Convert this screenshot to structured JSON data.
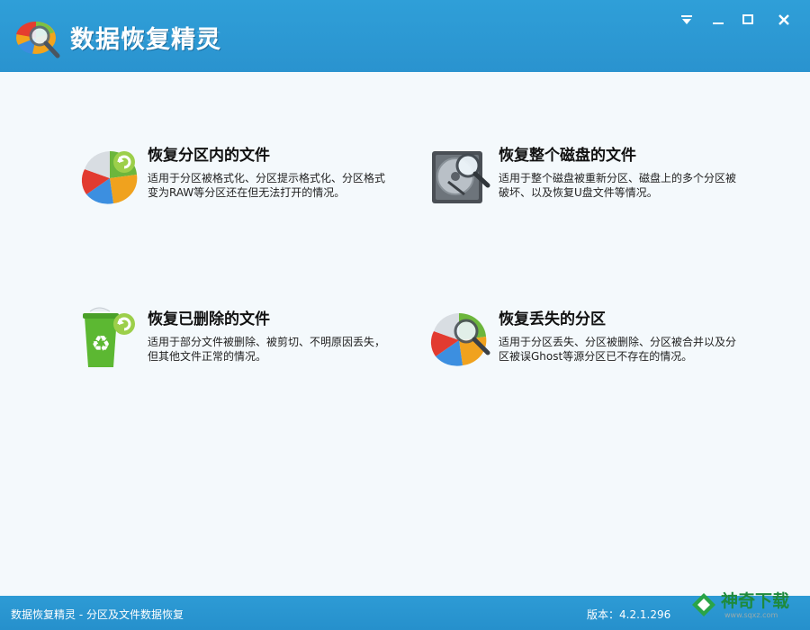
{
  "app": {
    "title": "数据恢复精灵"
  },
  "window_controls": {
    "dropdown": "dropdown-icon",
    "minimize": "minimize-icon",
    "maximize": "maximize-icon",
    "close": "close-icon"
  },
  "options": [
    {
      "title": "恢复分区内的文件",
      "description": "适用于分区被格式化、分区提示格式化、分区格式变为RAW等分区还在但无法打开的情况。",
      "icon": "partition-pie-icon"
    },
    {
      "title": "恢复整个磁盘的文件",
      "description": "适用于整个磁盘被重新分区、磁盘上的多个分区被破坏、以及恢复U盘文件等情况。",
      "icon": "disk-search-icon"
    },
    {
      "title": "恢复已删除的文件",
      "description": "适用于部分文件被删除、被剪切、不明原因丢失，但其他文件正常的情况。",
      "icon": "recycle-bin-icon"
    },
    {
      "title": "恢复丢失的分区",
      "description": "适用于分区丢失、分区被删除、分区被合并以及分区被误Ghost等源分区已不存在的情况。",
      "icon": "partition-search-icon"
    }
  ],
  "status": {
    "left": "数据恢复精灵 - 分区及文件数据恢复",
    "version": "版本：4.2.1.296"
  },
  "watermark": {
    "text": "神奇下载",
    "url": "www.sqxz.com"
  },
  "colors": {
    "titlebar": "#2f9fd8",
    "background": "#f4f9fc",
    "statusbar": "#2d9bd5"
  }
}
